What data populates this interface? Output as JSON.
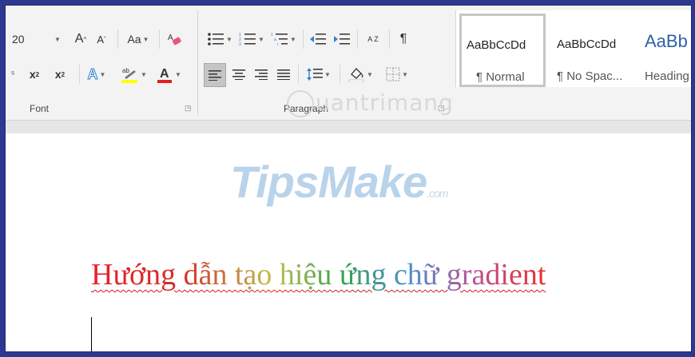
{
  "font": {
    "size_value": "20",
    "change_case_label": "Aa",
    "group_label": "Font",
    "font_color": "#e02020",
    "highlight_color": "#ffff00"
  },
  "paragraph": {
    "group_label": "Paragraph",
    "sort_label": "A Z",
    "pilcrow_label": "¶"
  },
  "styles": [
    {
      "sample": "AaBbCcDd",
      "name": "¶ Normal"
    },
    {
      "sample": "AaBbCcDd",
      "name": "¶ No Spac..."
    },
    {
      "sample": "AaBb",
      "name": "Heading"
    }
  ],
  "watermarks": {
    "logo_main": "TipsMake",
    "logo_suffix": ".com",
    "site": "uantrimang"
  },
  "document": {
    "heading_text": "Hướng dẫn tạo hiệu ứng chữ gradient"
  }
}
